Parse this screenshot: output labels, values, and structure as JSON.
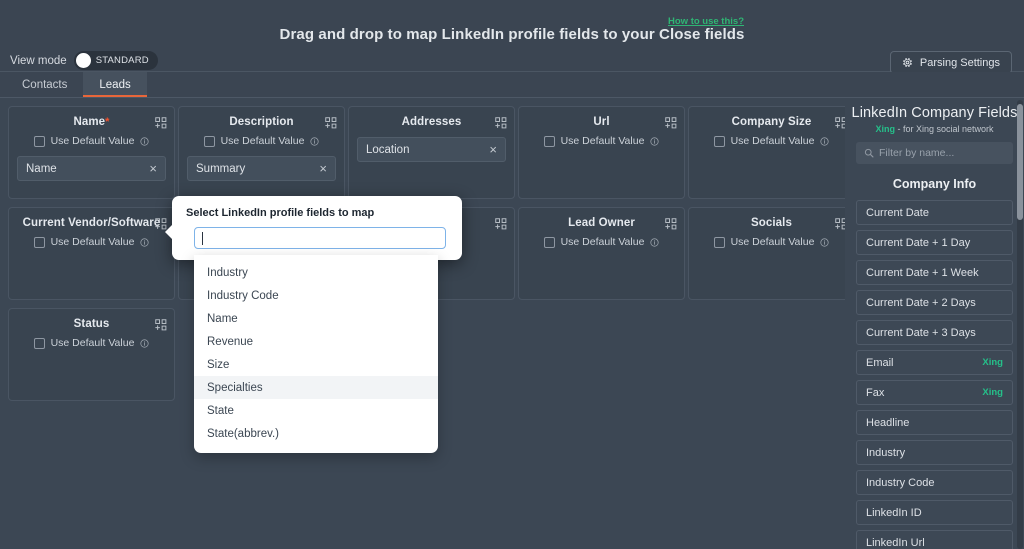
{
  "header": {
    "title": "Drag and drop to map LinkedIn profile fields to your Close fields",
    "howto_link": "How to use this?",
    "view_mode_label": "View mode",
    "view_mode_value": "STANDARD",
    "parsing_settings_label": "Parsing Settings"
  },
  "tabs": [
    {
      "label": "Contacts",
      "active": false
    },
    {
      "label": "Leads",
      "active": true
    }
  ],
  "common": {
    "use_default_value": "Use Default Value"
  },
  "cards": [
    {
      "title": "Name",
      "required": true,
      "show_default": true,
      "pill": "Name",
      "col": 0,
      "row": 0
    },
    {
      "title": "Description",
      "required": false,
      "show_default": true,
      "pill": "Summary",
      "col": 1,
      "row": 0
    },
    {
      "title": "Addresses",
      "required": false,
      "show_default": false,
      "pill": "Location",
      "col": 2,
      "row": 0
    },
    {
      "title": "Url",
      "required": false,
      "show_default": true,
      "pill": "",
      "col": 3,
      "row": 0
    },
    {
      "title": "Company Size",
      "required": false,
      "show_default": true,
      "pill": "",
      "col": 4,
      "row": 0
    },
    {
      "title": "Current Vendor/Software",
      "required": false,
      "show_default": true,
      "pill": "",
      "col": 0,
      "row": 1
    },
    {
      "title": "",
      "required": false,
      "show_default": true,
      "pill": "",
      "col": 1,
      "row": 1
    },
    {
      "title": "",
      "required": false,
      "show_default": false,
      "pill": "",
      "col": 2,
      "row": 1
    },
    {
      "title": "Lead Owner",
      "required": false,
      "show_default": true,
      "pill": "",
      "col": 3,
      "row": 1
    },
    {
      "title": "Socials",
      "required": false,
      "show_default": true,
      "pill": "",
      "col": 4,
      "row": 1
    },
    {
      "title": "Status",
      "required": false,
      "show_default": true,
      "pill": "",
      "col": 0,
      "row": 2
    }
  ],
  "sidebar": {
    "title": "LinkedIn Company Fields",
    "subtitle_tag": "Xing",
    "subtitle_rest": "- for Xing social network",
    "filter_placeholder": "Filter by name...",
    "section_title": "Company Info",
    "items": [
      {
        "label": "Current Date",
        "tag": ""
      },
      {
        "label": "Current Date + 1 Day",
        "tag": ""
      },
      {
        "label": "Current Date + 1 Week",
        "tag": ""
      },
      {
        "label": "Current Date + 2 Days",
        "tag": ""
      },
      {
        "label": "Current Date + 3 Days",
        "tag": ""
      },
      {
        "label": "Email",
        "tag": "Xing"
      },
      {
        "label": "Fax",
        "tag": "Xing"
      },
      {
        "label": "Headline",
        "tag": ""
      },
      {
        "label": "Industry",
        "tag": ""
      },
      {
        "label": "Industry Code",
        "tag": ""
      },
      {
        "label": "LinkedIn ID",
        "tag": ""
      },
      {
        "label": "LinkedIn Url",
        "tag": ""
      }
    ]
  },
  "popup": {
    "label": "Select LinkedIn profile fields to map",
    "input_value": "",
    "input_placeholder": "",
    "options": [
      {
        "label": "Industry",
        "highlighted": false
      },
      {
        "label": "Industry Code",
        "highlighted": false
      },
      {
        "label": "Name",
        "highlighted": false
      },
      {
        "label": "Revenue",
        "highlighted": false
      },
      {
        "label": "Size",
        "highlighted": false
      },
      {
        "label": "Specialties",
        "highlighted": true
      },
      {
        "label": "State",
        "highlighted": false
      },
      {
        "label": "State(abbrev.)",
        "highlighted": false
      }
    ]
  },
  "colors": {
    "background": "#3c4754",
    "card": "#394450",
    "accent_green": "#25c08a",
    "accent_orange": "#e8663a",
    "required_red": "#f4512c"
  }
}
